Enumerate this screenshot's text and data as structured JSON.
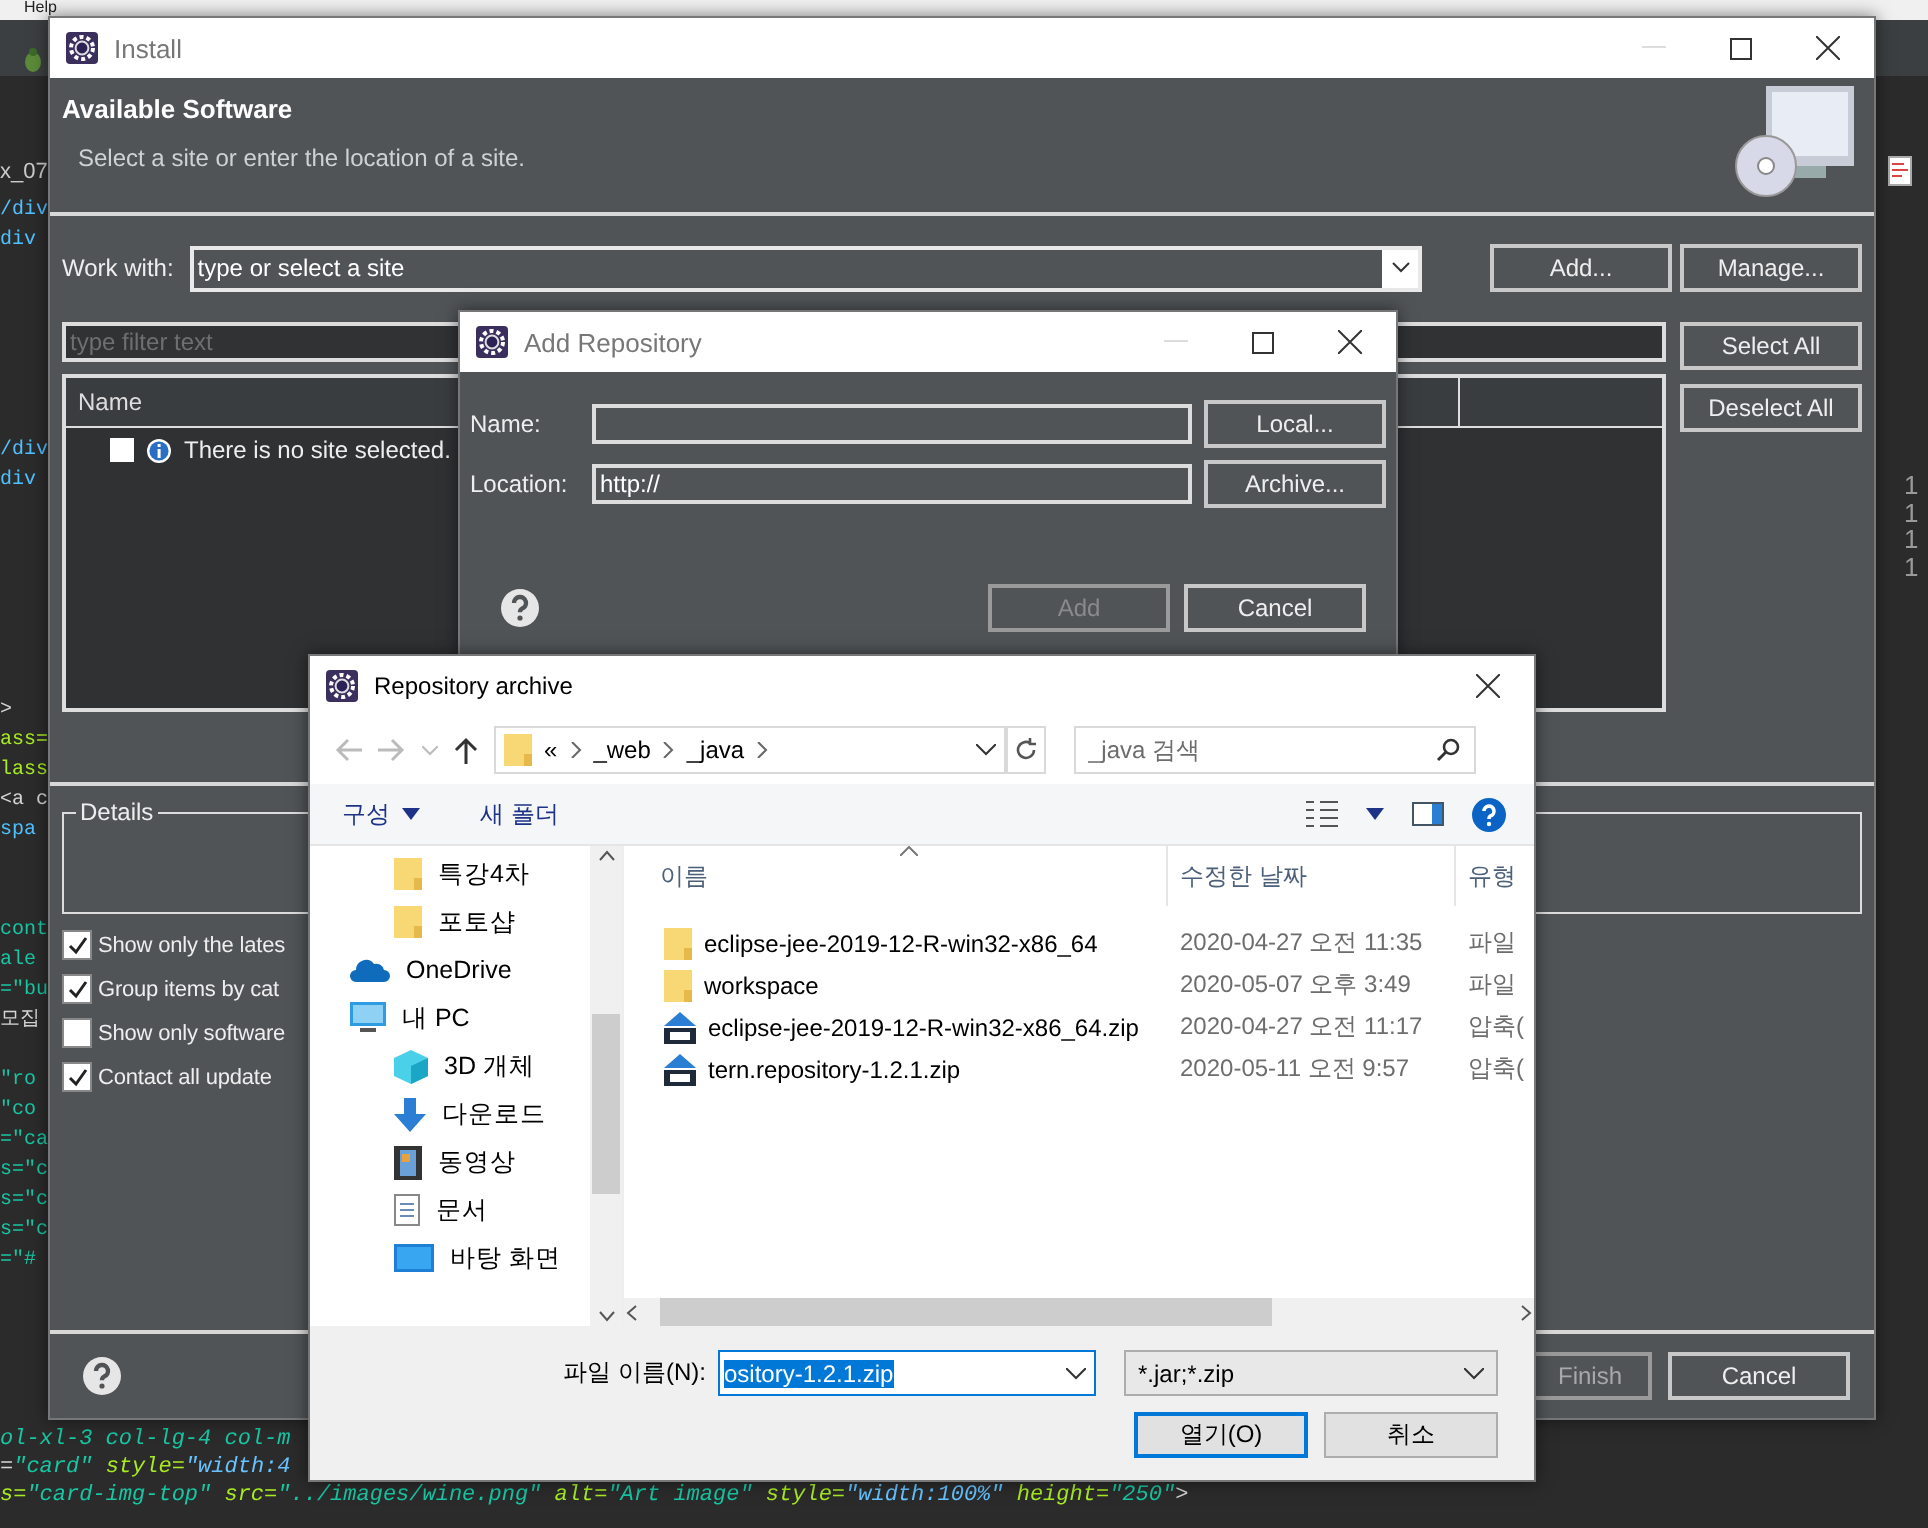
{
  "ide": {
    "menu": "Help",
    "tab": "x_07",
    "gutter": [
      [
        {
          "text": "/div",
          "color": "#4fc1ff"
        },
        {
          "text": "div",
          "color": "#4fc1ff"
        }
      ],
      [
        {
          "text": "/div",
          "color": "#4fc1ff"
        },
        {
          "text": "div",
          "color": "#4fc1ff"
        }
      ],
      [
        {
          "text": ">",
          "color": "#d4d4d4"
        },
        {
          "text": "ass=",
          "color": "#a7ec21"
        },
        {
          "text": "lass",
          "color": "#a7ec21"
        },
        {
          "text": "<a c",
          "color": "#d4d4d4"
        },
        {
          "text": "spa",
          "color": "#4fc1ff"
        }
      ],
      [
        {
          "text": "cont",
          "color": "#17c6a3"
        },
        {
          "text": "ale",
          "color": "#17c6a3"
        },
        {
          "text": "=\"bu",
          "color": "#17c6a3"
        },
        {
          "text": "모집",
          "color": "#d4d4d4"
        }
      ],
      [
        {
          "text": "\"ro",
          "color": "#17c6a3"
        },
        {
          "text": "\"co",
          "color": "#17c6a3"
        },
        {
          "text": "=\"ca",
          "color": "#17c6a3"
        },
        {
          "text": "s=\"c",
          "color": "#17c6a3"
        },
        {
          "text": "s=\"c",
          "color": "#17c6a3"
        },
        {
          "text": "s=\"c",
          "color": "#17c6a3"
        },
        {
          "text": "=\"#",
          "color": "#17c6a3"
        }
      ]
    ],
    "code_lines": [
      [
        {
          "text": "ol-xl-3 col-lg-4 col-m",
          "color": "#17c6a3"
        }
      ],
      [
        {
          "text": "=",
          "color": "#d4d4d4"
        },
        {
          "text": "\"card\"",
          "color": "#17c6a3"
        },
        {
          "text": " style=",
          "color": "#a7ec21"
        },
        {
          "text": "\"width:4",
          "color": "#66c3ff"
        }
      ],
      [
        {
          "text": "s=",
          "color": "#a7ec21"
        },
        {
          "text": "\"card-img-top\"",
          "color": "#17c6a3"
        },
        {
          "text": " src=",
          "color": "#a7ec21"
        },
        {
          "text": "\"../images/wine.png\"",
          "color": "#17c6a3"
        },
        {
          "text": " alt=",
          "color": "#a7ec21"
        },
        {
          "text": "\"Art image\"",
          "color": "#17c6a3"
        },
        {
          "text": " style=",
          "color": "#a7ec21"
        },
        {
          "text": "\"width:100%\"",
          "color": "#66c3ff"
        },
        {
          "text": " height=",
          "color": "#a7ec21"
        },
        {
          "text": "\"250\"",
          "color": "#17c6a3"
        },
        {
          "text": ">",
          "color": "#d4d4d4"
        }
      ]
    ],
    "line_numbers": [
      "1",
      "1",
      "1",
      "1"
    ]
  },
  "install": {
    "title": "Install",
    "heading": "Available Software",
    "subtitle": "Select a site or enter the location of a site.",
    "work_with_label": "Work with:",
    "site_value": "type or select a site",
    "add_button": "Add...",
    "manage_button": "Manage...",
    "filter_placeholder": "type filter text",
    "table": {
      "columns": [
        "Name"
      ],
      "rows": [
        {
          "checked": false,
          "text": "There is no site selected."
        }
      ]
    },
    "select_all": "Select All",
    "deselect_all": "Deselect All",
    "details_label": "Details",
    "options": [
      {
        "label": "Show only the lates",
        "checked": true
      },
      {
        "label": "Group items by cat",
        "checked": true
      },
      {
        "label": "Show only software",
        "checked": false
      },
      {
        "label": "Contact all update",
        "checked": true
      }
    ],
    "finish": {
      "label": "Finish",
      "disabled": true
    },
    "cancel": "Cancel"
  },
  "add_repository": {
    "title": "Add Repository",
    "name_label": "Name:",
    "location_label": "Location:",
    "location_value": "http://",
    "local_button": "Local...",
    "archive_button": "Archive...",
    "add": {
      "label": "Add",
      "disabled": true
    },
    "cancel": "Cancel"
  },
  "file_dialog": {
    "title": "Repository archive",
    "path": [
      "«",
      "_web",
      "_java"
    ],
    "search_placeholder": "_java 검색",
    "toolbar": {
      "organize": "구성",
      "new_folder": "새 폴더"
    },
    "nav": [
      {
        "kind": "group",
        "children": [
          {
            "label": "특강4차",
            "kind": "folder"
          },
          {
            "label": "포토샵",
            "kind": "folder"
          }
        ]
      },
      {
        "label": "OneDrive",
        "kind": "cloud"
      },
      {
        "label": "내 PC",
        "kind": "pc",
        "children": [
          {
            "label": "3D 개체",
            "kind": "cube"
          },
          {
            "label": "다운로드",
            "kind": "download"
          },
          {
            "label": "동영상",
            "kind": "video"
          },
          {
            "label": "문서",
            "kind": "document"
          },
          {
            "label": "바탕 화면",
            "kind": "desktop"
          }
        ]
      }
    ],
    "columns": [
      "이름",
      "수정한 날짜",
      "유형"
    ],
    "files": [
      {
        "kind": "folder",
        "name": "eclipse-jee-2019-12-R-win32-x86_64",
        "date": "2020-04-27 오전 11:35",
        "type": "파일"
      },
      {
        "kind": "folder",
        "name": "workspace",
        "date": "2020-05-07 오후 3:49",
        "type": "파일"
      },
      {
        "kind": "zip",
        "name": "eclipse-jee-2019-12-R-win32-x86_64.zip",
        "date": "2020-04-27 오전 11:17",
        "type": "압축("
      },
      {
        "kind": "zip",
        "name": "tern.repository-1.2.1.zip",
        "date": "2020-05-11 오전 9:57",
        "type": "압축("
      }
    ],
    "filename_label": "파일 이름(N):",
    "filename_value": "ository-1.2.1.zip",
    "filter": "*.jar;*.zip",
    "open": "열기(O)",
    "cancel": "취소"
  }
}
